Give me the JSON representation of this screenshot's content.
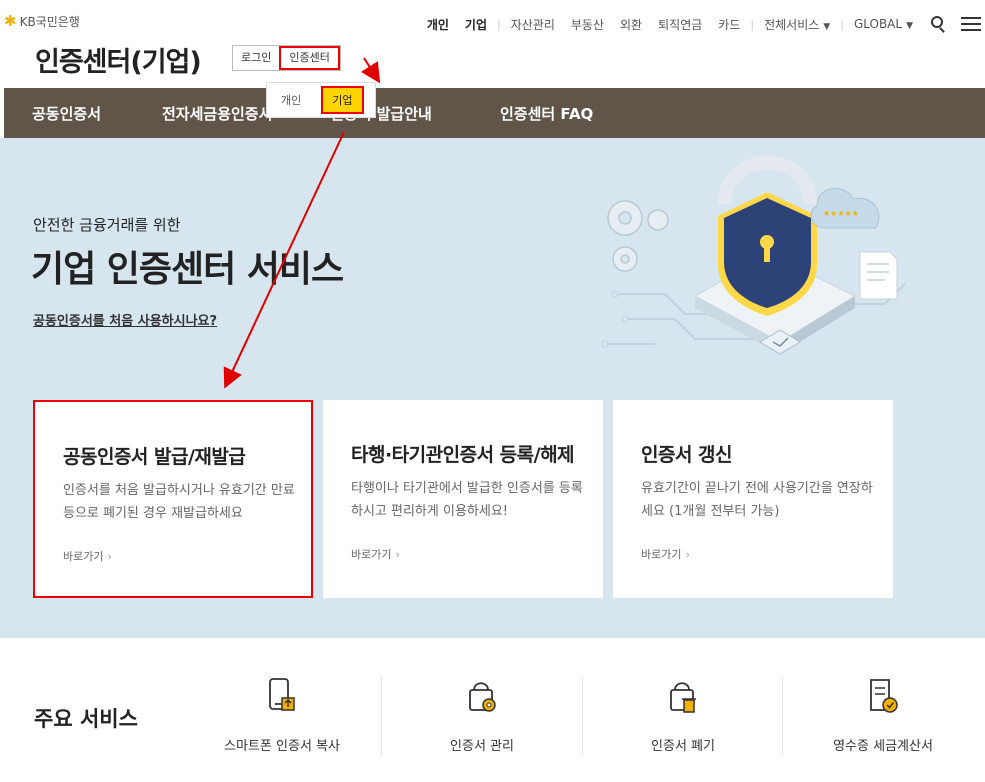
{
  "header": {
    "logo_mark": "✱",
    "logo_text": "KB국민은행",
    "nav": [
      {
        "label": "개인",
        "strong": true
      },
      {
        "label": "기업",
        "strong": true
      },
      {
        "label": "자산관리"
      },
      {
        "label": "부동산"
      },
      {
        "label": "외환"
      },
      {
        "label": "퇴직연금"
      },
      {
        "label": "카드"
      },
      {
        "label": "전체서비스"
      },
      {
        "label": "GLOBAL"
      }
    ]
  },
  "page": {
    "title": "인증센터(기업)",
    "toggle_login": "로그인",
    "toggle_cert": "인증센터"
  },
  "popup": {
    "personal": "개인",
    "business": "기업"
  },
  "gnb": [
    "공동인증서",
    "전자세금용인증서",
    "인증서 발급안내",
    "인증센터 FAQ"
  ],
  "hero": {
    "sub": "안전한 금융거래를 위한",
    "title": "기업 인증센터 서비스",
    "link": "공동인증서를 처음 사용하시나요?"
  },
  "cards": [
    {
      "title": "공동인증서 발급/재발급",
      "desc": "인증서를 처음 발급하시거나 유효기간 만료 등으로 폐기된 경우 재발급하세요",
      "link": "바로가기"
    },
    {
      "title": "타행·타기관인증서 등록/해제",
      "desc": "타행이나 타기관에서 발급한 인증서를 등록하시고 편리하게 이용하세요!",
      "link": "바로가기"
    },
    {
      "title": "인증서 갱신",
      "desc": "유효기간이 끝나기 전에 사용기간을 연장하세요 (1개월 전부터 가능)",
      "link": "바로가기"
    }
  ],
  "main_services": {
    "title": "주요 서비스",
    "items": [
      {
        "label": "스마트폰 인증서 복사",
        "icon": "phone-upload-icon"
      },
      {
        "label": "인증서 관리",
        "icon": "lock-gear-icon"
      },
      {
        "label": "인증서 폐기",
        "icon": "lock-trash-icon"
      },
      {
        "label": "영수증 세금계산서",
        "icon": "receipt-check-icon"
      }
    ]
  },
  "colors": {
    "gnb_bg": "#605548",
    "hero_bg": "#d6e5ee",
    "highlight": "#ffd400",
    "annotation_red": "#e00000",
    "brand_yellow": "#f2b100"
  }
}
